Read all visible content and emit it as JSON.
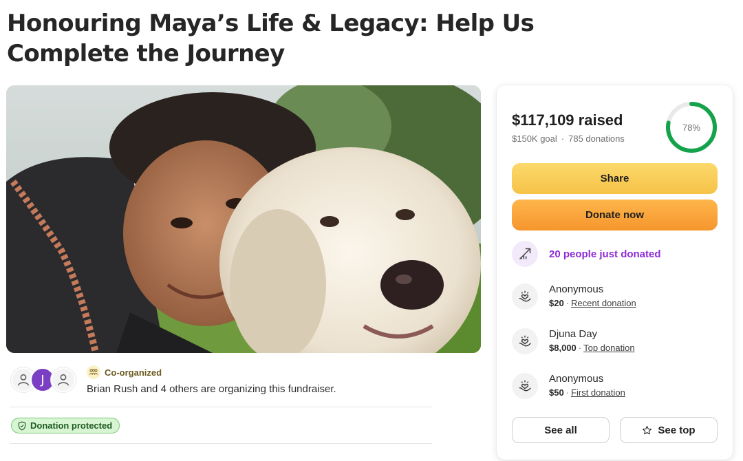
{
  "page": {
    "title": "Honouring Maya’s Life & Legacy: Help Us Complete the Journey"
  },
  "organizers": {
    "avatar_initial": "J",
    "badge_label": "Co-organized",
    "text": "Brian Rush and 4 others are organizing this fundraiser."
  },
  "protection": {
    "label": "Donation protected"
  },
  "campaign": {
    "raised": "$117,109 raised",
    "goal": "$150K goal",
    "separator": "·",
    "donations": "785 donations",
    "progress_percent": 78,
    "progress_label": "78%",
    "share_label": "Share",
    "donate_label": "Donate now",
    "trending": "20 people just donated"
  },
  "recent_donations": [
    {
      "name": "Anonymous",
      "amount": "$20",
      "sep": "·",
      "type": "Recent donation"
    },
    {
      "name": "Djuna Day",
      "amount": "$8,000",
      "sep": "·",
      "type": "Top donation"
    },
    {
      "name": "Anonymous",
      "amount": "$50",
      "sep": "·",
      "type": "First donation"
    }
  ],
  "actions": {
    "see_all": "See all",
    "see_top": "See top"
  },
  "colors": {
    "progress": "#14a34a",
    "share": "#f6c247",
    "donate": "#f6962d",
    "trending": "#8e2bd6"
  }
}
